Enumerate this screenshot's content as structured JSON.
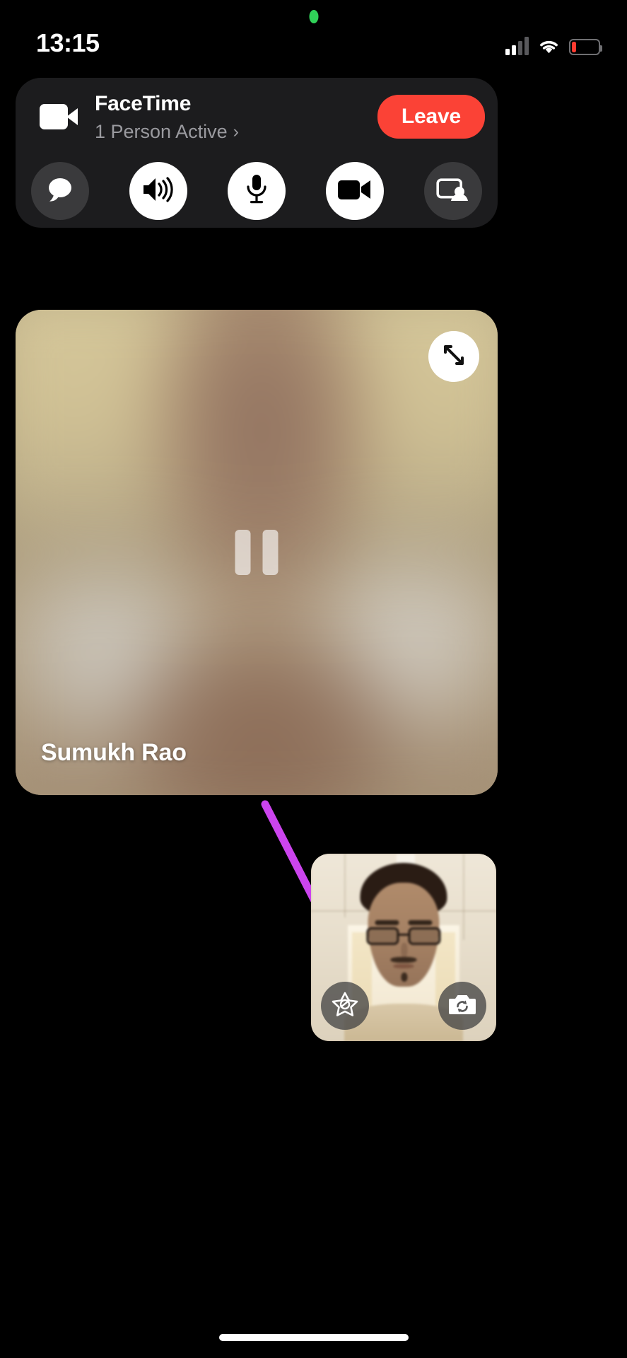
{
  "status_bar": {
    "time": "13:15",
    "recording_indicator": "green-camera-dot",
    "cellular_icon": "signal-bars-icon",
    "wifi_icon": "wifi-icon",
    "battery_icon": "battery-low-icon",
    "battery_level_percent": 15,
    "battery_color": "#ff3b30"
  },
  "banner": {
    "app_icon": "facetime-video-icon",
    "title": "FaceTime",
    "subtitle": "1 Person Active",
    "chevron": "›",
    "leave_label": "Leave",
    "leave_color": "#fb4236",
    "controls": [
      {
        "name": "messages-button",
        "icon": "speech-bubble-icon",
        "state": "off",
        "label": "Messages"
      },
      {
        "name": "speaker-button",
        "icon": "speaker-wave-icon",
        "state": "on",
        "label": "Speaker"
      },
      {
        "name": "microphone-button",
        "icon": "microphone-icon",
        "state": "on",
        "label": "Mute"
      },
      {
        "name": "camera-button",
        "icon": "video-camera-icon",
        "state": "on",
        "label": "Camera"
      },
      {
        "name": "shareplay-button",
        "icon": "screen-share-person-icon",
        "state": "off",
        "label": "SharePlay"
      }
    ]
  },
  "main_tile": {
    "participant_name": "Sumukh Rao",
    "expand_icon": "expand-arrows-icon",
    "paused_icon": "pause-icon",
    "video_state": "paused-blurred"
  },
  "annotation": {
    "type": "arrow",
    "color": "#cc44ee",
    "points_to": "self-view-pip"
  },
  "pip": {
    "label": "Self View",
    "effects_icon": "effects-star-icon",
    "flip_camera_icon": "camera-flip-icon"
  },
  "home_indicator": "home-indicator"
}
